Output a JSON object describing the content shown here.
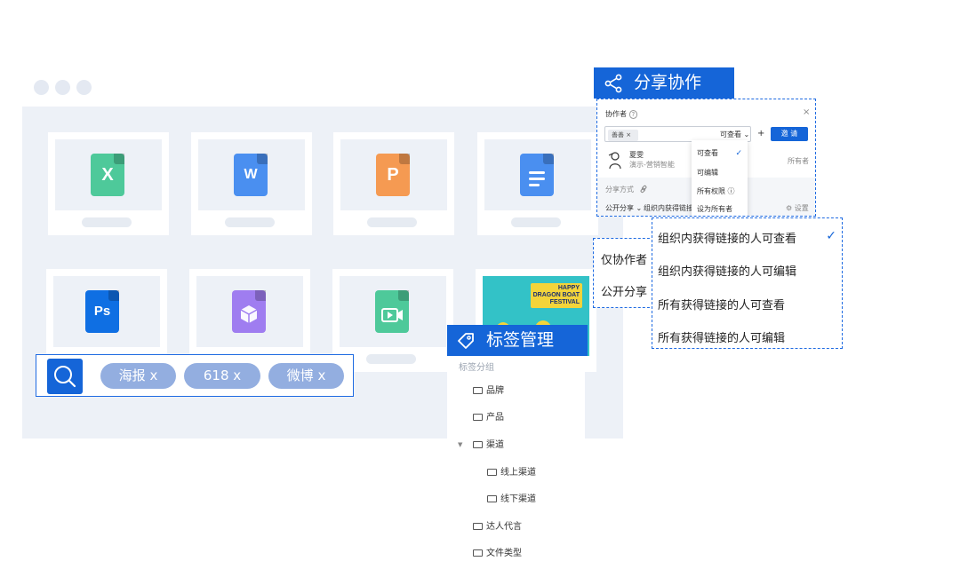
{
  "colors": {
    "brand": "#1565d8",
    "excel": "#4ec99a",
    "word": "#4a8ff0",
    "ppt": "#f59a52",
    "docs": "#4a8ff0",
    "ps": "#0f6fe3",
    "box3d": "#9f7df0",
    "video": "#4ec99a"
  },
  "file_icons": [
    "excel-icon",
    "word-icon",
    "ppt-icon",
    "document-icon",
    "photoshop-icon",
    "3d-box-icon",
    "video-icon"
  ],
  "file_glyphs": {
    "excel": "X",
    "word": "W",
    "ppt": "P",
    "ps": "Ps"
  },
  "poster": {
    "text": "HAPPY\nDRAGON BOAT\nFESTIVAL"
  },
  "search": {
    "tags": [
      {
        "label": "海报 x"
      },
      {
        "label": "618 x"
      },
      {
        "label": "微博 x"
      }
    ]
  },
  "tag_panel": {
    "title": "标签管理",
    "subtitle": "标签分组",
    "items": [
      "品牌",
      "产品",
      "渠道",
      "线上渠道",
      "线下渠道",
      "达人代言",
      "文件类型"
    ]
  },
  "share_panel": {
    "title": "分享协作",
    "collaborators_label": "协作者",
    "help_mark": "?",
    "close": "×",
    "chip": "善善 ×",
    "permission_value": "可查看 ⌄",
    "plus": "+",
    "invite_label": "邀 请",
    "user_name": "夏雯",
    "user_sub": "演示-营销智能",
    "owner_label": "所有者",
    "share_method_label": "分享方式",
    "share_mode": "公开分享 ⌄",
    "share_link_text": "组织内获得链接的",
    "settings_label": "设置",
    "dropdown": {
      "options": [
        "可查看",
        "可编辑",
        "所有权限 ⓘ",
        "设为所有者"
      ],
      "selected": "可查看",
      "check": "✓"
    }
  },
  "side_labels": [
    "仅协作者",
    "公开分享"
  ],
  "link_options": {
    "items": [
      "组织内获得链接的人可查看",
      "组织内获得链接的人可编辑",
      "所有获得链接的人可查看",
      "所有获得链接的人可编辑"
    ],
    "selected": "组织内获得链接的人可查看",
    "check": "✓"
  }
}
